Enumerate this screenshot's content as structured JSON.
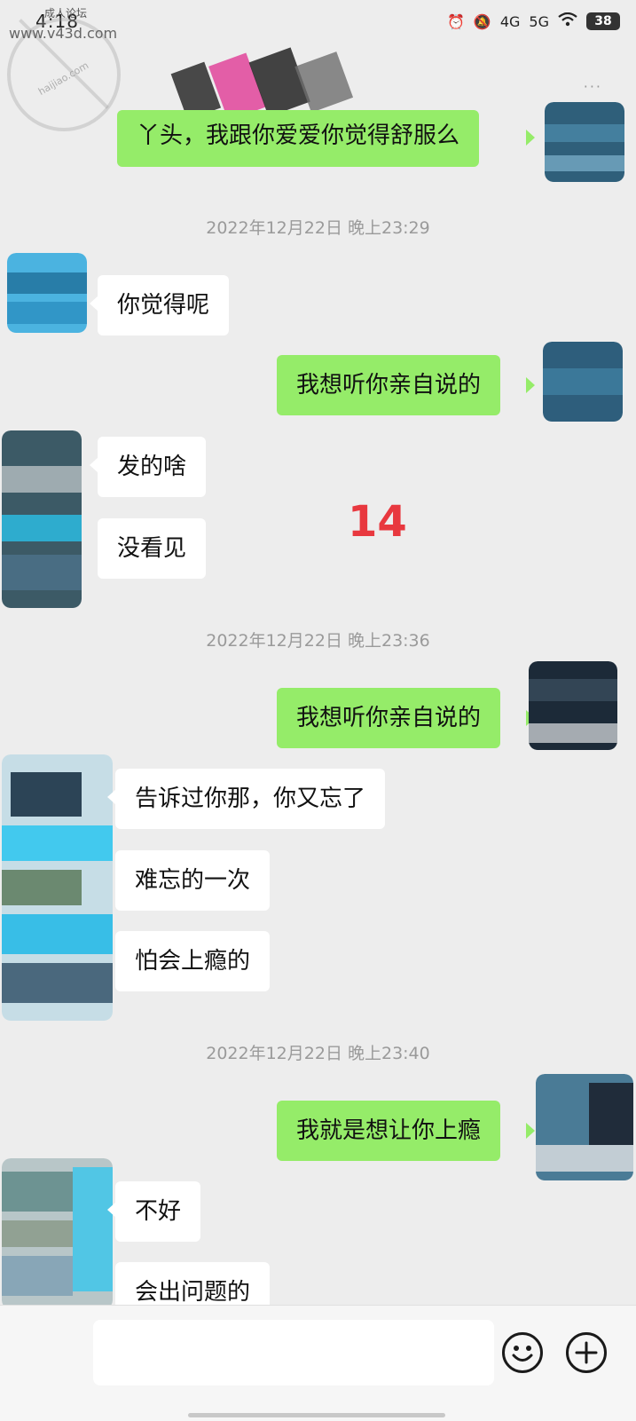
{
  "status_bar": {
    "time": "4:18",
    "signal_1": "4G",
    "signal_2": "5G",
    "battery": "38"
  },
  "watermark": {
    "top_text": "成人论坛",
    "url": "www.v43d.com",
    "sub_text": "haijiao.com"
  },
  "header": {
    "menu_dots": "···"
  },
  "overlay_number": "14",
  "messages": [
    {
      "side": "out",
      "text": "丫头，我跟你爱爱你觉得舒服么"
    },
    {
      "side": "time",
      "text": "2022年12月22日 晚上23:29"
    },
    {
      "side": "in",
      "text": "你觉得呢"
    },
    {
      "side": "out",
      "text": "我想听你亲自说的"
    },
    {
      "side": "in",
      "text": "发的啥"
    },
    {
      "side": "in",
      "text": "没看见"
    },
    {
      "side": "time",
      "text": "2022年12月22日 晚上23:36"
    },
    {
      "side": "out",
      "text": "我想听你亲自说的"
    },
    {
      "side": "in",
      "text": "告诉过你那，你又忘了"
    },
    {
      "side": "in",
      "text": "难忘的一次"
    },
    {
      "side": "in",
      "text": "怕会上瘾的"
    },
    {
      "side": "time",
      "text": "2022年12月22日 晚上23:40"
    },
    {
      "side": "out",
      "text": "我就是想让你上瘾"
    },
    {
      "side": "in",
      "text": "不好"
    },
    {
      "side": "in",
      "text": "会出问题的"
    }
  ],
  "input_bar": {
    "value": "",
    "emoji_icon": "smiley-face-icon",
    "plus_icon": "plus-circle-icon"
  },
  "colors": {
    "background": "#ededed",
    "outgoing_bubble": "#95ec69",
    "incoming_bubble": "#ffffff",
    "overlay_number": "#e8383f"
  }
}
